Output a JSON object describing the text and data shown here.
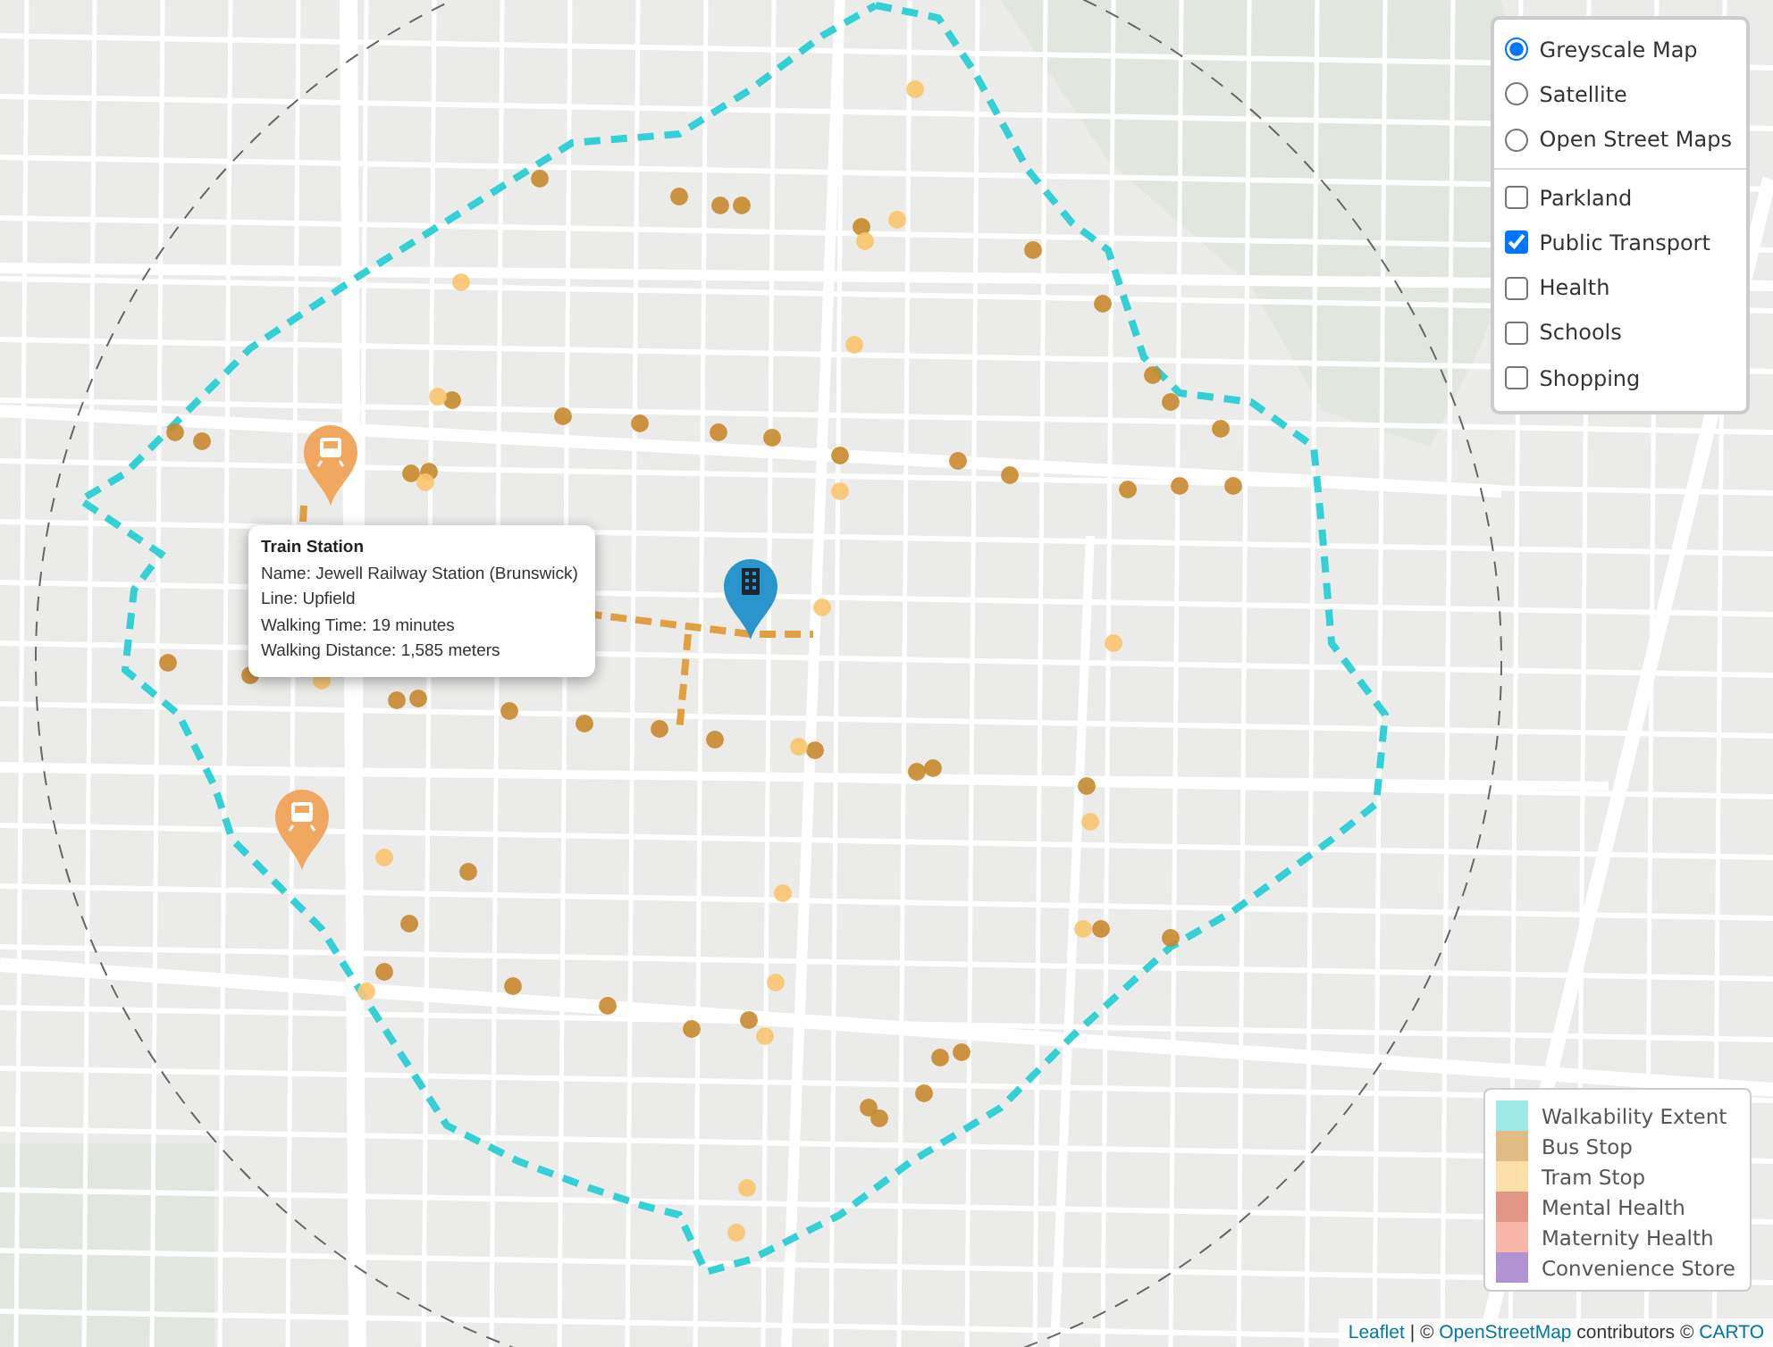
{
  "map": {
    "popup": {
      "title": "Train Station",
      "lines": [
        "Name: Jewell Railway Station (Brunswick)",
        "Line: Upfield",
        "Walking Time: 19 minutes",
        "Walking Distance: 1,585 meters"
      ]
    }
  },
  "layer_control": {
    "base_layers": [
      {
        "label": "Greyscale Map",
        "selected": true
      },
      {
        "label": "Satellite",
        "selected": false
      },
      {
        "label": "Open Street Maps",
        "selected": false
      }
    ],
    "overlays": [
      {
        "label": "Parkland",
        "checked": false
      },
      {
        "label": "Public Transport",
        "checked": true
      },
      {
        "label": "Health",
        "checked": false
      },
      {
        "label": "Schools",
        "checked": false
      },
      {
        "label": "Shopping",
        "checked": false
      }
    ]
  },
  "legend": [
    {
      "label": "Walkability Extent",
      "color": "#9ee8e8"
    },
    {
      "label": "Bus Stop",
      "color": "#e0bb84"
    },
    {
      "label": "Tram Stop",
      "color": "#fde0a9"
    },
    {
      "label": "Mental Health",
      "color": "#e29686"
    },
    {
      "label": "Maternity Health",
      "color": "#f7b6a8"
    },
    {
      "label": "Convenience Store",
      "color": "#b094d2"
    }
  ],
  "attribution": {
    "parts": [
      {
        "kind": "link",
        "text": "Leaflet"
      },
      {
        "kind": "text",
        "text": " | © "
      },
      {
        "kind": "link",
        "text": "OpenStreetMap"
      },
      {
        "kind": "text",
        "text": " contributors © "
      },
      {
        "kind": "link",
        "text": "CARTO"
      }
    ]
  }
}
